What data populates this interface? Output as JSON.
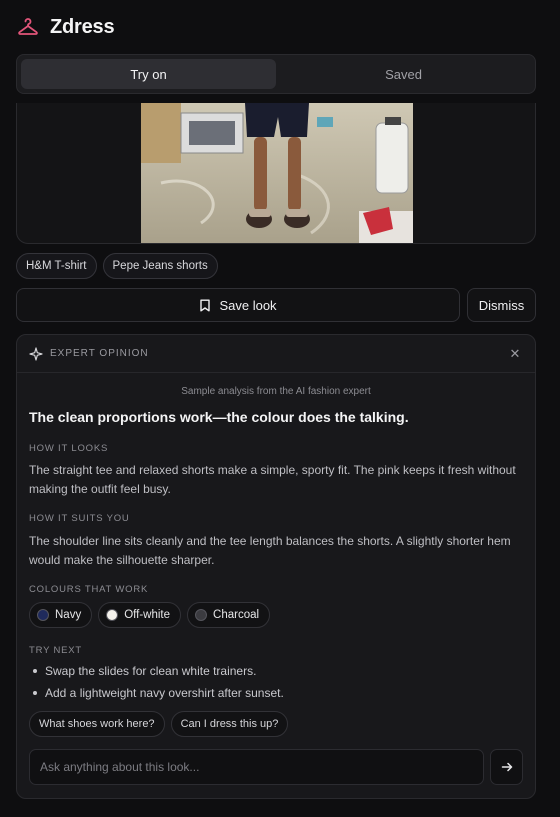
{
  "app": {
    "title": "Zdress",
    "logo_icon": "hanger-icon",
    "accent": "#e2557a"
  },
  "tabs": [
    {
      "label": "Try on",
      "active": true
    },
    {
      "label": "Saved",
      "active": false
    }
  ],
  "garment_tags": [
    "H&M T-shirt",
    "Pepe Jeans shorts"
  ],
  "actions": {
    "save_label": "Save look",
    "save_icon": "bookmark-icon",
    "dismiss_label": "Dismiss"
  },
  "expert": {
    "label": "EXPERT OPINION",
    "icon": "sparkle-icon",
    "sample_note": "Sample analysis from the AI fashion expert",
    "headline": "The clean proportions work—the colour does the talking.",
    "how_it_looks": {
      "label": "HOW IT LOOKS",
      "text": "The straight tee and relaxed shorts make a simple, sporty fit. The pink keeps it fresh without making the outfit feel busy."
    },
    "how_it_suits": {
      "label": "HOW IT SUITS YOU",
      "text": "The shoulder line sits cleanly and the tee length balances the shorts. A slightly shorter hem would make the silhouette sharper."
    },
    "colours": {
      "label": "COLOURS THAT WORK",
      "items": [
        {
          "name": "Navy",
          "color": "#1f2a5c"
        },
        {
          "name": "Off-white",
          "color": "#f4f2ec"
        },
        {
          "name": "Charcoal",
          "color": "#3b3b40"
        }
      ]
    },
    "try_next": {
      "label": "TRY NEXT",
      "items": [
        "Swap the slides for clean white trainers.",
        "Add a lightweight navy overshirt after sunset."
      ]
    },
    "suggestions": [
      "What shoes work here?",
      "Can I dress this up?"
    ],
    "ask": {
      "placeholder": "Ask anything about this look..."
    }
  }
}
